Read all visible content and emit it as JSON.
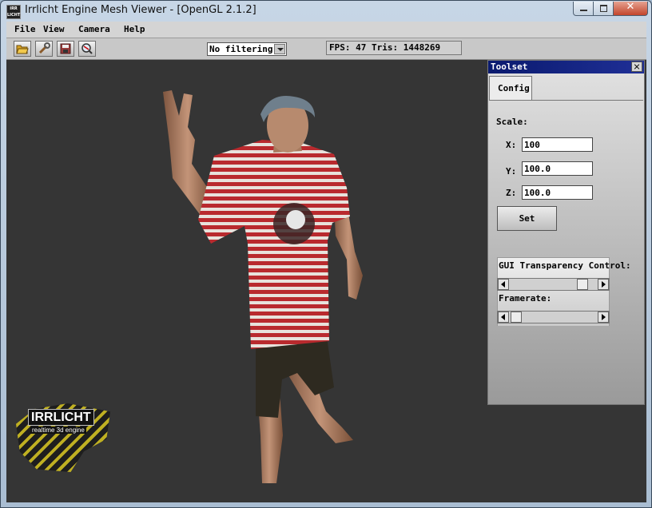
{
  "window": {
    "title": "Irrlicht Engine Mesh Viewer - [OpenGL 2.1.2]",
    "app_icon_text": "IRR LICHT"
  },
  "menubar": {
    "items": [
      "File",
      "View",
      "Camera",
      "Help"
    ]
  },
  "toolbar": {
    "buttons": [
      "open-folder-icon",
      "settings-wrench-icon",
      "save-icon",
      "zoom-magnifier-icon"
    ],
    "filter": {
      "selected": "No filtering"
    },
    "stats": {
      "text": "FPS: 47 Tris: 1448269"
    }
  },
  "logo": {
    "title": "IRRLICHT",
    "subtitle": "realtime 3d engine"
  },
  "toolset": {
    "title": "Toolset",
    "tabs": [
      "Config"
    ],
    "scale_label": "Scale:",
    "x_label": "X:",
    "y_label": "Y:",
    "z_label": "Z:",
    "x_value": "100",
    "y_value": "100.0",
    "z_value": "100.0",
    "set_label": "Set",
    "transparency_label": "GUI Transparency Control:",
    "transparency_value": 0.88,
    "framerate_label": "Framerate:",
    "framerate_value": 0.02
  },
  "colors": {
    "viewport_bg": "#353535",
    "titlebar_close": "#c3452c",
    "toolset_title": "#0a1a6e",
    "shirt_red": "#b92a2e",
    "shirt_white": "#e8e2dc",
    "skin": "#b98a6c",
    "shorts": "#2e2a20",
    "bandana": "#6f7f8c"
  }
}
